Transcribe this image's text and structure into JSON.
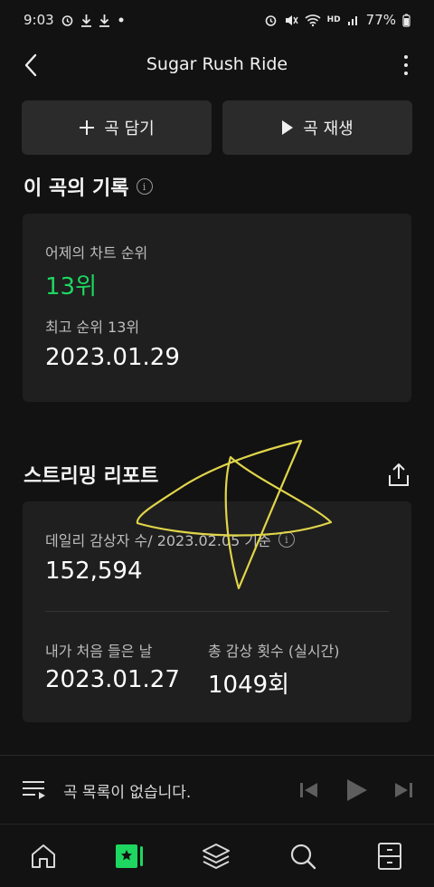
{
  "status": {
    "time": "9:03",
    "battery": "77%",
    "hd_label": "HD",
    "left_icons": [
      "alarm-icon",
      "download-icon",
      "download-icon",
      "dot-icon"
    ],
    "right_icons": [
      "alarm-icon",
      "mute-icon",
      "wifi-icon",
      "signal-icon",
      "battery-icon"
    ]
  },
  "header": {
    "title": "Sugar Rush Ride"
  },
  "actions": {
    "add_label": "곡 담기",
    "play_label": "곡 재생"
  },
  "record": {
    "title": "이 곡의 기록",
    "chart_label": "어제의 차트 순위",
    "chart_rank": "13위",
    "best_label": "최고 순위 13위",
    "best_date": "2023.01.29"
  },
  "streaming": {
    "title": "스트리밍 리포트",
    "daily_label": "데일리 감상자 수/ 2023.02.05 기준",
    "daily_value": "152,594",
    "first_label": "내가 처음 들은 날",
    "first_value": "2023.01.27",
    "total_label": "총 감상 횟수 (실시간)",
    "total_value": "1049회"
  },
  "player": {
    "text": "곡 목록이 없습니다."
  },
  "tabs": [
    "home-icon",
    "my-music-icon",
    "library-icon",
    "search-icon",
    "drawer-icon"
  ],
  "colors": {
    "background": "#121212",
    "card": "#1f1f1f",
    "accent": "#1ed760",
    "scribble": "#e0d54a"
  }
}
